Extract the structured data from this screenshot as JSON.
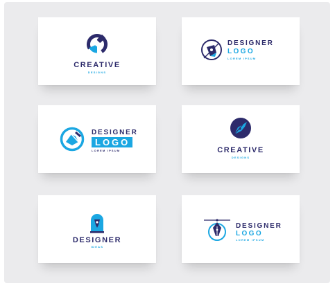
{
  "cards": [
    {
      "name": "creative-designs",
      "title": "CREATIVE",
      "subtitle": "DESIGNS"
    },
    {
      "name": "designer-logo-nib",
      "title": "DESIGNER",
      "word": "LOGO",
      "tagline": "LOREM IPSUM"
    },
    {
      "name": "designer-logo-circle",
      "title": "DESIGNER",
      "word": "LOGO",
      "tagline": "LOREM IPSUM"
    },
    {
      "name": "creative-designs-nib",
      "title": "CREATIVE",
      "subtitle": "DESIGNS"
    },
    {
      "name": "designer-ideas",
      "title": "DESIGNER",
      "subtitle": "IDEAS"
    },
    {
      "name": "designer-logo-pen",
      "title": "DESIGNER",
      "word": "LOGO",
      "tagline": "LOREM IPSUM"
    }
  ],
  "colors": {
    "navy": "#2d2b6b",
    "cyan": "#1ba7e2",
    "panel": "#ebebed"
  },
  "icons": [
    "pencil-circle-icon",
    "pen-nib-circle-icon",
    "arrow-circle-icon",
    "nib-circle-icon",
    "pen-nib-arch-icon",
    "pen-nib-line-icon"
  ]
}
